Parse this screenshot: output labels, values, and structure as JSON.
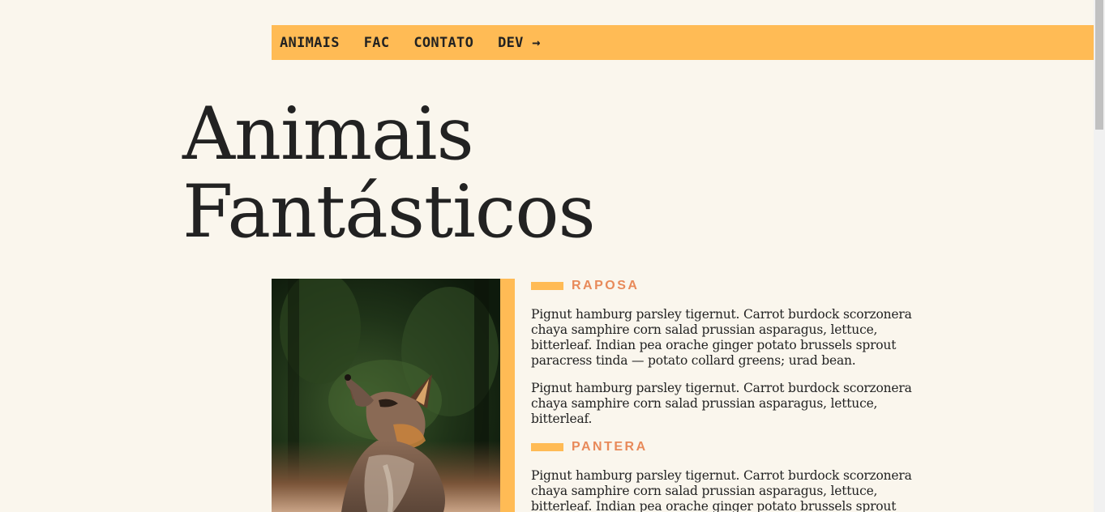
{
  "nav": {
    "items": [
      "ANIMAIS",
      "FAC",
      "CONTATO",
      "DEV →"
    ]
  },
  "hero": {
    "line1": "Animais",
    "line2": "Fantásticos"
  },
  "animals": [
    {
      "name": "RAPOSA",
      "paragraph1": "Pignut hamburg parsley tigernut. Carrot burdock scorzonera chaya samphire corn salad prussian asparagus, lettuce, bitterleaf. Indian pea orache ginger potato brussels sprout paracress tinda — potato collard greens; urad bean.",
      "paragraph2": "Pignut hamburg parsley tigernut. Carrot burdock scorzonera chaya samphire corn salad prussian asparagus, lettuce, bitterleaf."
    },
    {
      "name": "PANTERA",
      "paragraph1": "Pignut hamburg parsley tigernut. Carrot burdock scorzonera chaya samphire corn salad prussian asparagus, lettuce, bitterleaf. Indian pea orache ginger potato brussels sprout paracress tinda — potato collard greens; urad bean."
    }
  ],
  "colors": {
    "background": "#FAF6ED",
    "accent": "#FFBB55",
    "title_accent": "#E88A5A",
    "text": "#222222"
  }
}
